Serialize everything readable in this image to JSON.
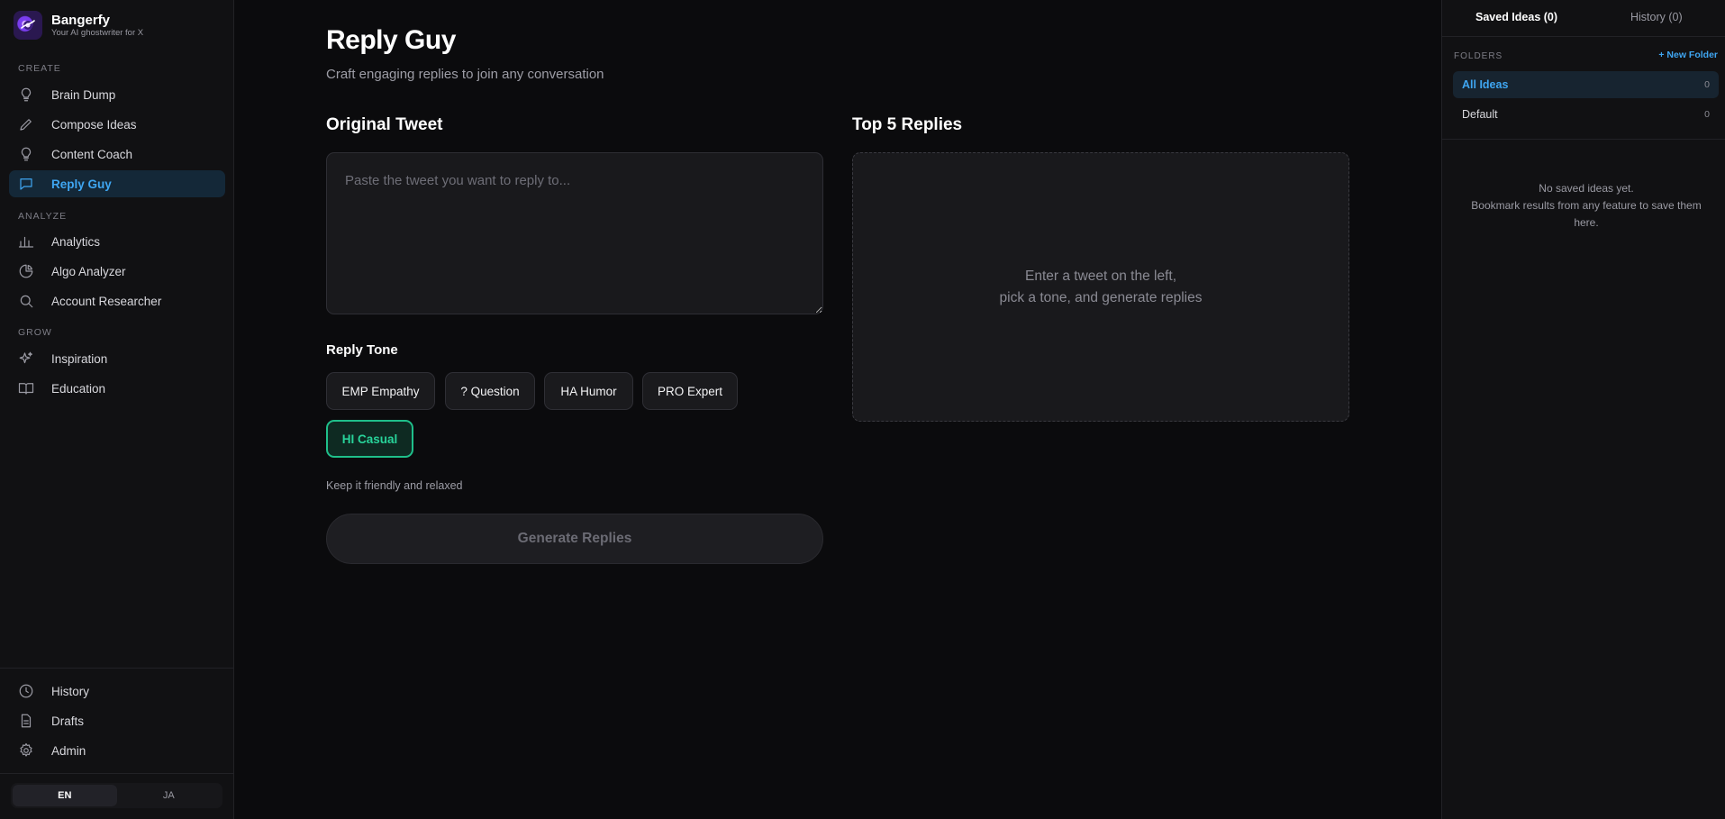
{
  "brand": {
    "name": "Bangerfy",
    "tagline": "Your AI ghostwriter for X"
  },
  "sidebar": {
    "sections": [
      {
        "label": "CREATE"
      },
      {
        "label": "ANALYZE"
      },
      {
        "label": "GROW"
      }
    ],
    "items": [
      {
        "label": "Brain Dump",
        "icon": "lightbulb-icon"
      },
      {
        "label": "Compose Ideas",
        "icon": "pencil-icon"
      },
      {
        "label": "Content Coach",
        "icon": "bulb-icon"
      },
      {
        "label": "Reply Guy",
        "icon": "chat-bubble-icon",
        "active": true
      },
      {
        "label": "Analytics",
        "icon": "bar-chart-icon"
      },
      {
        "label": "Algo Analyzer",
        "icon": "pie-chart-icon"
      },
      {
        "label": "Account Researcher",
        "icon": "search-icon"
      },
      {
        "label": "Inspiration",
        "icon": "sparkles-icon"
      },
      {
        "label": "Education",
        "icon": "book-icon"
      }
    ],
    "bottom_items": [
      {
        "label": "History",
        "icon": "clock-icon"
      },
      {
        "label": "Drafts",
        "icon": "document-icon"
      },
      {
        "label": "Admin",
        "icon": "gear-icon"
      }
    ],
    "languages": [
      {
        "label": "EN",
        "active": true
      },
      {
        "label": "JA",
        "active": false
      }
    ]
  },
  "main": {
    "title": "Reply Guy",
    "subtitle": "Craft engaging replies to join any conversation",
    "original_tweet": {
      "heading": "Original Tweet",
      "placeholder": "Paste the tweet you want to reply to...",
      "value": ""
    },
    "replies": {
      "heading": "Top 5 Replies",
      "empty_line1": "Enter a tweet on the left,",
      "empty_line2": "pick a tone, and generate replies"
    },
    "tone": {
      "heading": "Reply Tone",
      "options": [
        {
          "label": "EMP Empathy"
        },
        {
          "label": "? Question"
        },
        {
          "label": "HA Humor"
        },
        {
          "label": "PRO Expert"
        },
        {
          "label": "HI Casual",
          "selected": true
        }
      ],
      "hint": "Keep it friendly and relaxed"
    },
    "generate_label": "Generate Replies"
  },
  "right_panel": {
    "tabs": [
      {
        "label": "Saved Ideas (0)",
        "active": true
      },
      {
        "label": "History (0)",
        "active": false
      }
    ],
    "folders_label": "FOLDERS",
    "new_folder_label": "+ New Folder",
    "folders": [
      {
        "name": "All Ideas",
        "count": "0",
        "active": true
      },
      {
        "name": "Default",
        "count": "0",
        "active": false
      }
    ],
    "empty_line1": "No saved ideas yet.",
    "empty_line2": "Bookmark results from any feature to save them here."
  },
  "colors": {
    "background": "#0b0b0d",
    "sidebar": "#111113",
    "accent_blue": "#3fa6f2",
    "accent_green": "#1fbf8a"
  }
}
